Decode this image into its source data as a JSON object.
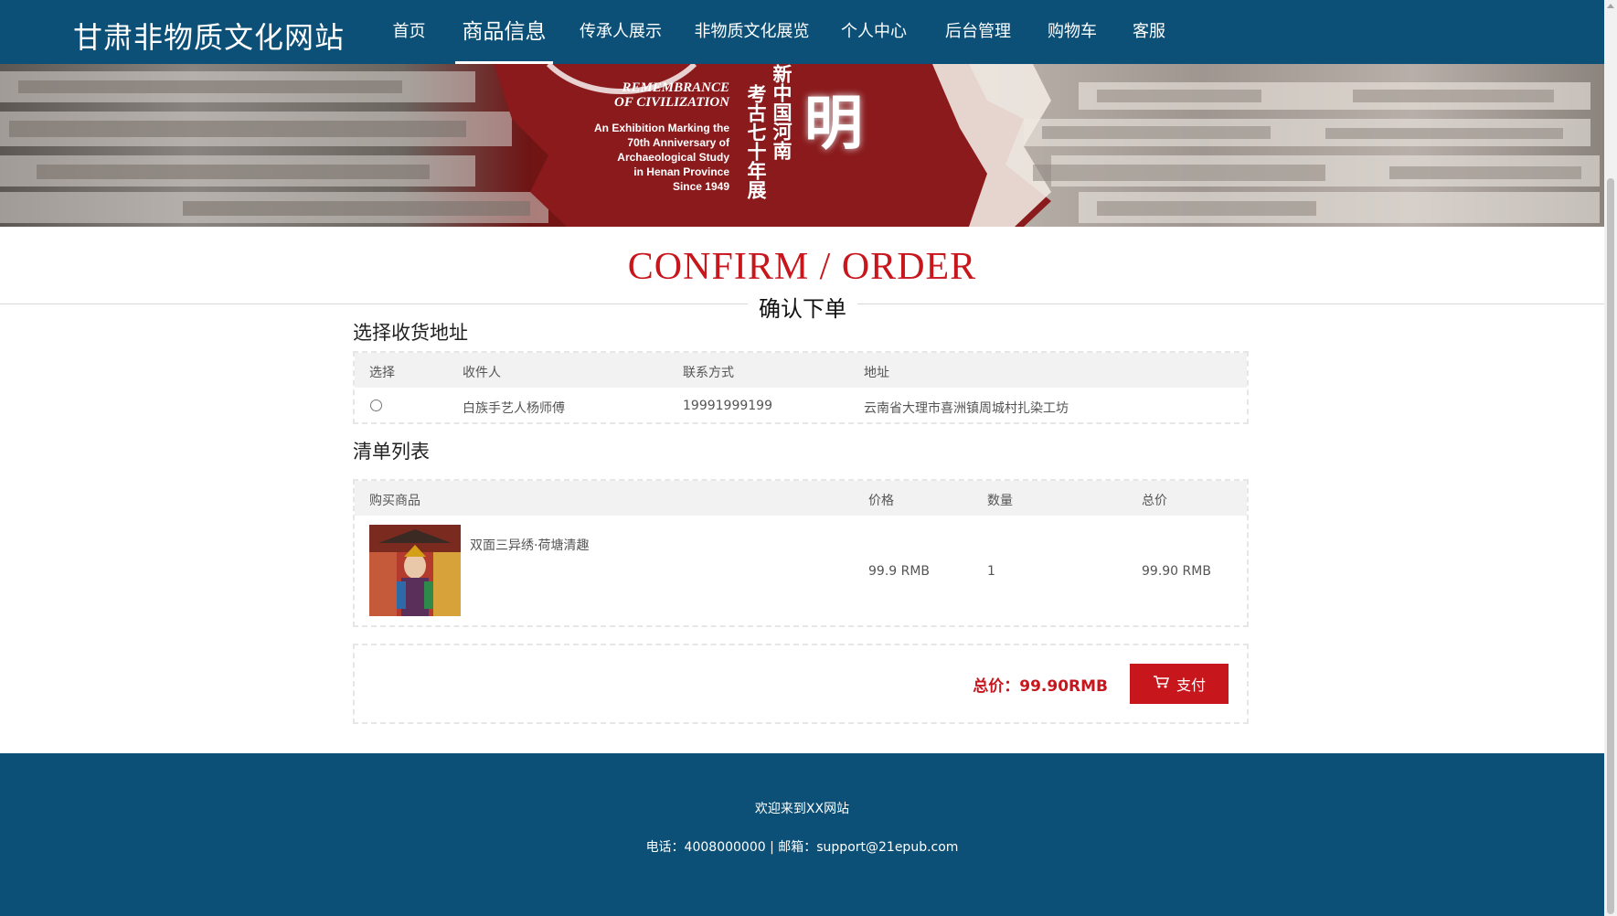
{
  "header": {
    "site_title": "甘肃非物质文化网站",
    "nav": [
      {
        "label": "首页"
      },
      {
        "label": "商品信息"
      },
      {
        "label": "传承人展示"
      },
      {
        "label": "非物质文化展览"
      },
      {
        "label": "个人中心"
      },
      {
        "label": "后台管理"
      },
      {
        "label": "购物车"
      },
      {
        "label": "客服"
      }
    ],
    "active_index": 1
  },
  "banner": {
    "lines": [
      "REMEMBRANCE",
      "OF CIVILIZATION",
      "An Exhibition Marking the",
      "70th Anniversary of",
      "Archaeological Study",
      "in Henan Province",
      "Since 1949"
    ],
    "vertical_text_1": "新中国河南",
    "vertical_text_2": "考古七十年展",
    "big_char": "明"
  },
  "titles": {
    "en": "CONFIRM / ORDER",
    "cn": "确认下单"
  },
  "address": {
    "heading": "选择收货地址",
    "columns": [
      "选择",
      "收件人",
      "联系方式",
      "地址"
    ],
    "rows": [
      {
        "recipient": "白族手艺人杨师傅",
        "phone": "19991999199",
        "address": "云南省大理市喜洲镇周城村扎染工坊",
        "selected": false
      }
    ]
  },
  "items": {
    "heading": "清单列表",
    "columns": [
      "购买商品",
      "价格",
      "数量",
      "总价"
    ],
    "rows": [
      {
        "name": "双面三异绣·荷塘清趣",
        "price": "99.9 RMB",
        "qty": "1",
        "total": "99.90 RMB"
      }
    ]
  },
  "summary": {
    "total_label": "总价：99.90RMB",
    "pay_label": "支付"
  },
  "footer": {
    "welcome": "欢迎来到XX网站",
    "contact": "电话：4008000000 | 邮箱：support@21epub.com"
  },
  "colors": {
    "header_bg": "#0c5077",
    "accent_red": "#c8161d"
  }
}
